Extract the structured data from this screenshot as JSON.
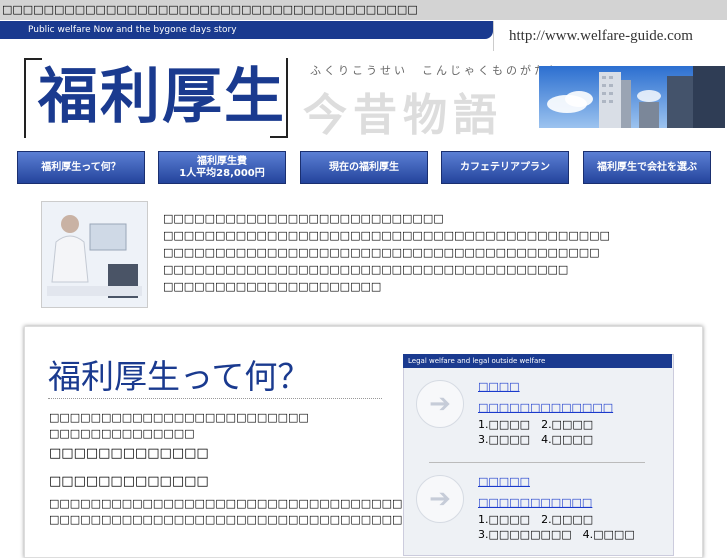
{
  "header": {
    "top_title": "□□□□□□□□□□□□□□□□□□□□□□□□□□□□□□□□□□□□□□□□",
    "tagline": "Public welfare Now and the bygone days story",
    "url": "http://www.welfare-guide.com",
    "logo_text": "福利厚生",
    "subtitle_kana": "ふくりこうせい　こんじゃくものがたり",
    "subtitle_big": "今昔物語"
  },
  "nav": [
    {
      "label": "福利厚生って何？"
    },
    {
      "label": "福利厚生費\n1人平均28,000円"
    },
    {
      "label": "現在の福利厚生"
    },
    {
      "label": "カフェテリアプラン"
    },
    {
      "label": "福利厚生で会社を選ぶ"
    }
  ],
  "intro": {
    "lines": [
      "□□□□□□□□□□□□□□□□□□□□□□□□□□□",
      "□□□□□□□□□□□□□□□□□□□□□□□□□□□□□□□□□□□□□□□□□□□",
      "□□□□□□□□□□□□□□□□□□□□□□□□□□□□□□□□□□□□□□□□□□",
      "□□□□□□□□□□□□□□□□□□□□□□□□□□□□□□□□□□□□□□□",
      "□□□□□□□□□□□□□□□□□□□□□"
    ]
  },
  "main": {
    "heading": "福利厚生って何？",
    "para1": [
      "□□□□□□□□□□□□□□□□□□□□□□□□□",
      "□□□□□□□□□□□□□□"
    ],
    "big1": "□□□□□□□□□□□□□",
    "big2": "□□□□□□□□□□□□□",
    "para2": [
      "□□□□□□□□□□□□□□□□□□□□□□□□□□□□□□□□□□□□□□□□□□□□□□□□□□□□□□□□□□",
      "□□□□□□□□□□□□□□□□□□□□□□□□□□□□□□□□□□□□□□□□□□□□□□□□□□□□□□□□□□□"
    ]
  },
  "sidebox": {
    "header": "Legal welfare and legal outside welfare",
    "section1": {
      "title": "□□□□",
      "subtitle": "□□□□□□□□□□□□□",
      "row1": "1.□□□□　2.□□□□",
      "row2": "3.□□□□　4.□□□□"
    },
    "section2": {
      "title": "□□□□□",
      "subtitle": "□□□□□□□□□□□",
      "row1": "1.□□□□　2.□□□□",
      "row2": "3.□□□□□□□□　4.□□□□"
    }
  }
}
